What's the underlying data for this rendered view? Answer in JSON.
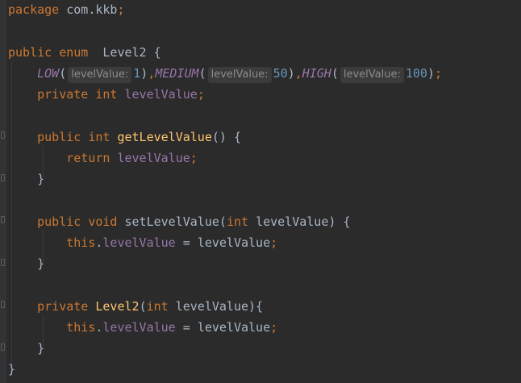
{
  "colors": {
    "background": "#2b2b2b",
    "keyword": "#cc7832",
    "field": "#9876aa",
    "method": "#ffc66d",
    "number": "#6897bb",
    "text": "#a9b7c6",
    "hint": "#8c8c8c"
  },
  "code": {
    "l1": {
      "kw": "package",
      "rest": "com.kkb",
      "semi": ";"
    },
    "l3": {
      "kw1": "public",
      "kw2": "enum",
      "name": "Level2",
      "brace": "{"
    },
    "l4": {
      "c1": "LOW",
      "h1": "levelValue:",
      "v1": "1",
      "c2": "MEDIUM",
      "h2": "levelValue:",
      "v2": "50",
      "c3": "HIGH",
      "h3": "levelValue:",
      "v3": "100"
    },
    "l5": {
      "kw1": "private",
      "kw2": "int",
      "fld": "levelValue"
    },
    "l7": {
      "kw1": "public",
      "kw2": "int",
      "mth": "getLevelValue",
      "rest": "() {"
    },
    "l8": {
      "kw": "return",
      "fld": "levelValue"
    },
    "l9": {
      "brace": "}"
    },
    "l11": {
      "kw1": "public",
      "kw2": "void",
      "mth": "setLevelValue",
      "kw3": "int",
      "param": "levelValue",
      "rest": ") {"
    },
    "l12": {
      "kw": "this",
      "fld": "levelValue",
      "rhs": "levelValue"
    },
    "l13": {
      "brace": "}"
    },
    "l15": {
      "kw1": "private",
      "ctor": "Level2",
      "kw2": "int",
      "param": "levelValue",
      "rest": "){"
    },
    "l16": {
      "kw": "this",
      "fld": "levelValue",
      "rhs": "levelValue"
    },
    "l17": {
      "brace": "}"
    },
    "l18": {
      "brace": "}"
    }
  }
}
